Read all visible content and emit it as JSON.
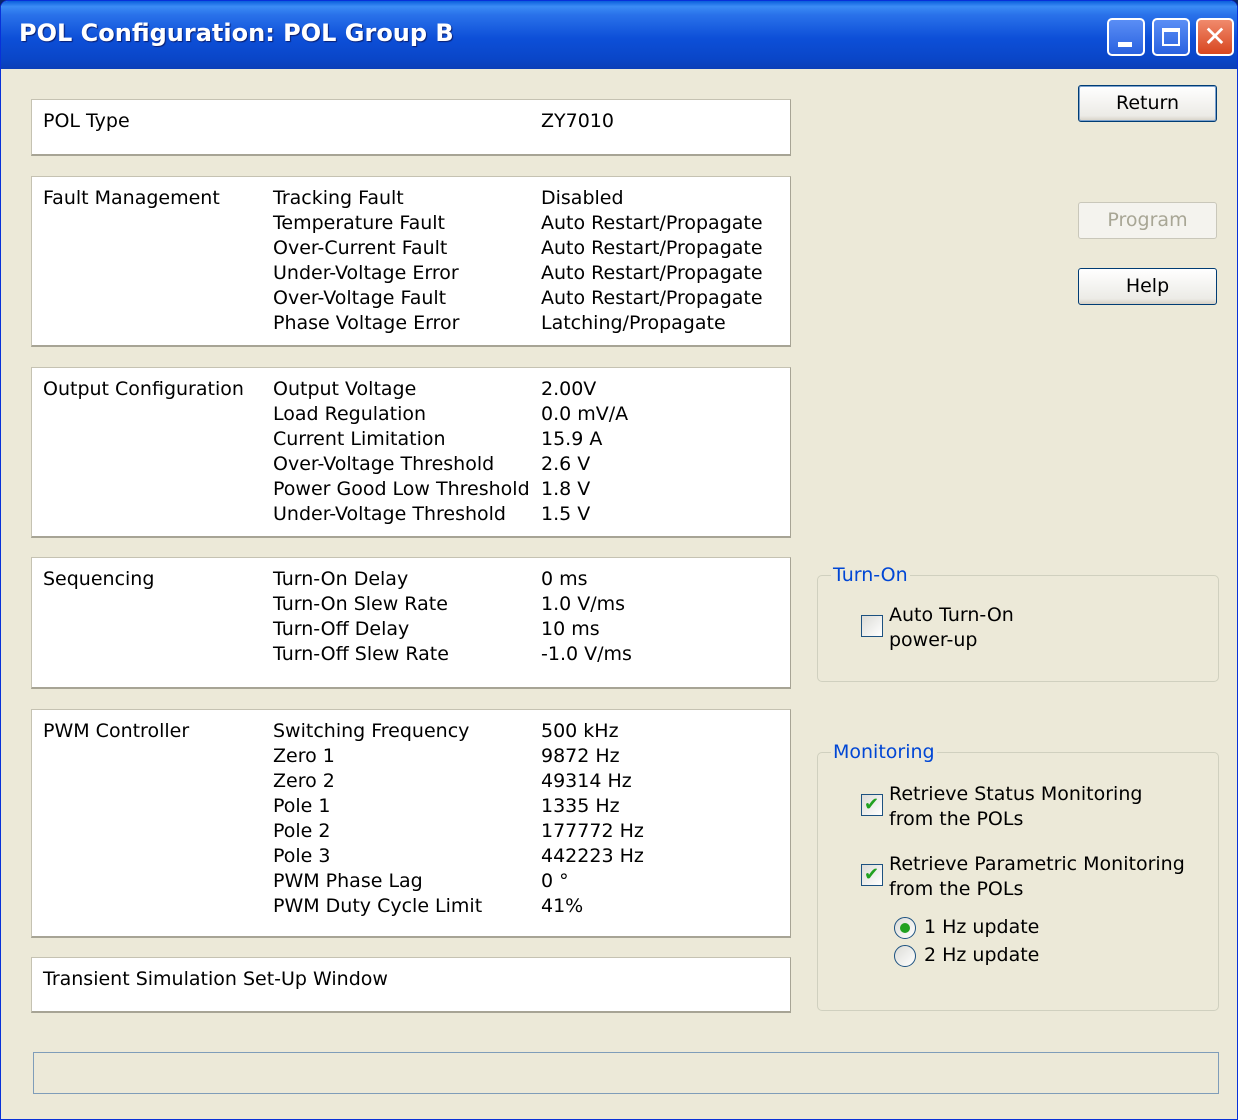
{
  "window": {
    "title": "POL Configuration: POL Group B",
    "close_glyph": "✕"
  },
  "pol_type": {
    "category": "POL Type",
    "value": "ZY7010"
  },
  "fault_management": {
    "category": "Fault Management",
    "labels": [
      "Tracking Fault",
      "Temperature Fault",
      "Over-Current Fault",
      "Under-Voltage Error",
      "Over-Voltage Fault",
      "Phase Voltage Error"
    ],
    "values": [
      "Disabled",
      "Auto Restart/Propagate",
      "Auto Restart/Propagate",
      "Auto Restart/Propagate",
      "Auto Restart/Propagate",
      "Latching/Propagate"
    ]
  },
  "output_configuration": {
    "category": "Output Configuration",
    "labels": [
      "Output Voltage",
      "Load Regulation",
      "Current Limitation",
      "Over-Voltage Threshold",
      "Power Good Low Threshold",
      "Under-Voltage Threshold"
    ],
    "values": [
      "2.00V",
      "0.0 mV/A",
      "15.9 A",
      "2.6 V",
      "1.8 V",
      "1.5 V"
    ]
  },
  "sequencing": {
    "category": "Sequencing",
    "labels": [
      "Turn-On Delay",
      "Turn-On Slew Rate",
      "Turn-Off Delay",
      "Turn-Off Slew Rate"
    ],
    "values": [
      "0 ms",
      "1.0 V/ms",
      "10 ms",
      "-1.0 V/ms"
    ]
  },
  "pwm_controller": {
    "category": "PWM Controller",
    "labels": [
      "Switching Frequency",
      "Zero 1",
      "Zero 2",
      "Pole 1",
      "Pole 2",
      "Pole 3",
      "PWM Phase Lag",
      "PWM Duty Cycle Limit"
    ],
    "values": [
      "500 kHz",
      "9872 Hz",
      "49314 Hz",
      "1335 Hz",
      "177772 Hz",
      "442223 Hz",
      "0 °",
      "41%"
    ]
  },
  "transient": {
    "label": "Transient Simulation Set-Up Window"
  },
  "buttons": {
    "return": "Return",
    "program": "Program",
    "help": "Help"
  },
  "turn_on": {
    "legend": "Turn-On",
    "auto_line1": "Auto Turn-On",
    "auto_line2": "power-up",
    "auto_checked": false
  },
  "monitoring": {
    "legend": "Monitoring",
    "status_line1": "Retrieve Status Monitoring",
    "status_line2": "from the POLs",
    "status_checked": true,
    "param_line1": "Retrieve Parametric Monitoring",
    "param_line2": "from the POLs",
    "param_checked": true,
    "check_glyph": "✔",
    "rate_1hz": "1 Hz update",
    "rate_2hz": "2 Hz update",
    "selected_rate": "1 Hz update"
  },
  "status_bar": {
    "text": ""
  }
}
